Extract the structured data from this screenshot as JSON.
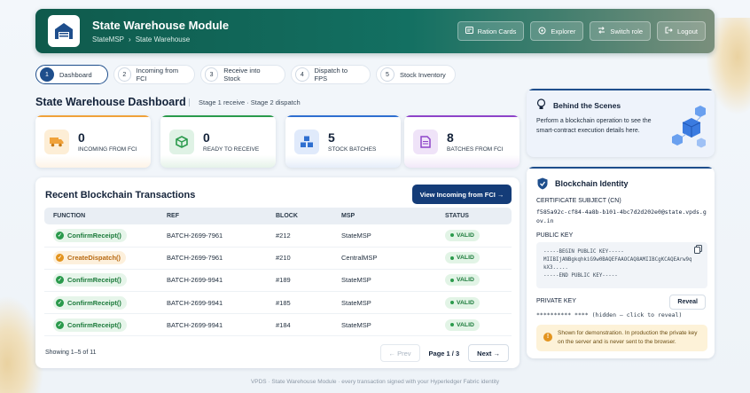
{
  "header": {
    "title": "State Warehouse Module",
    "breadcrumb": [
      "StateMSP",
      "State Warehouse"
    ],
    "buttons": {
      "ration_cards": "Ration Cards",
      "explorer": "Explorer",
      "switch_role": "Switch role",
      "logout": "Logout"
    }
  },
  "steps": [
    {
      "num": "1",
      "label": "Dashboard",
      "active": true
    },
    {
      "num": "2",
      "label": "Incoming from FCI"
    },
    {
      "num": "3",
      "label": "Receive into Stock"
    },
    {
      "num": "4",
      "label": "Dispatch to FPS"
    },
    {
      "num": "5",
      "label": "Stock Inventory"
    }
  ],
  "dashboard": {
    "title": "State Warehouse Dashboard",
    "subtitle": "Stage 1 receive · Stage 2 dispatch"
  },
  "stats": [
    {
      "value": "0",
      "label": "INCOMING FROM FCI",
      "icon": "truck-icon",
      "color": "#f0a23a"
    },
    {
      "value": "0",
      "label": "READY TO RECEIVE",
      "icon": "box-icon",
      "color": "#2a9a4c"
    },
    {
      "value": "5",
      "label": "STOCK BATCHES",
      "icon": "boxes-icon",
      "color": "#2f6fd0"
    },
    {
      "value": "8",
      "label": "BATCHES FROM FCI",
      "icon": "document-icon",
      "color": "#8e44c9"
    }
  ],
  "transactions": {
    "title": "Recent Blockchain Transactions",
    "view_button": "View Incoming from FCI →",
    "columns": [
      "FUNCTION",
      "REF",
      "BLOCK",
      "MSP",
      "STATUS"
    ],
    "rows": [
      {
        "function": "ConfirmReceipt()",
        "ref": "BATCH-2699-7961",
        "block": "#212",
        "msp": "StateMSP",
        "status": "VALID",
        "tone": "green"
      },
      {
        "function": "CreateDispatch()",
        "ref": "BATCH-2699-7961",
        "block": "#210",
        "msp": "CentralMSP",
        "status": "VALID",
        "tone": "amber"
      },
      {
        "function": "ConfirmReceipt()",
        "ref": "BATCH-2699-9941",
        "block": "#189",
        "msp": "StateMSP",
        "status": "VALID",
        "tone": "green"
      },
      {
        "function": "ConfirmReceipt()",
        "ref": "BATCH-2699-9941",
        "block": "#185",
        "msp": "StateMSP",
        "status": "VALID",
        "tone": "green"
      },
      {
        "function": "ConfirmReceipt()",
        "ref": "BATCH-2699-9941",
        "block": "#184",
        "msp": "StateMSP",
        "status": "VALID",
        "tone": "green"
      }
    ],
    "showing": "Showing 1–5 of 11",
    "prev": "← Prev",
    "page_info": "Page 1 / 3",
    "next": "Next →"
  },
  "behind_scenes": {
    "title": "Behind the Scenes",
    "text": "Perform a blockchain operation to see the smart-contract execution details here."
  },
  "identity": {
    "title": "Blockchain Identity",
    "cert_label": "CERTIFICATE SUBJECT (CN)",
    "cert_value": "f585a92c-cf84-4a8b-b101-4bc7d2d202e0@state.vpds.gov.in",
    "public_key_label": "PUBLIC KEY",
    "public_key_lines": [
      "-----BEGIN PUBLIC KEY-----",
      "MIIBIjANBgkqhkiG9w0BAQEFAAOCAQ8AMIIBCgKCAQEArw9qkX3.....",
      "-----END PUBLIC KEY-----"
    ],
    "private_key_label": "PRIVATE KEY",
    "reveal": "Reveal",
    "private_key_value": "********** ****  (hidden — click to reveal)",
    "warning": "Shown for demonstration. In production the private key on the server and is never sent to the browser."
  },
  "footer": "VPDS · State Warehouse Module · every transaction signed with your Hyperledger Fabric identity",
  "colors": {
    "header_green": "#0f5a4c",
    "primary_navy": "#143c78",
    "valid_green": "#2a9a4c",
    "amber": "#e3941f"
  }
}
